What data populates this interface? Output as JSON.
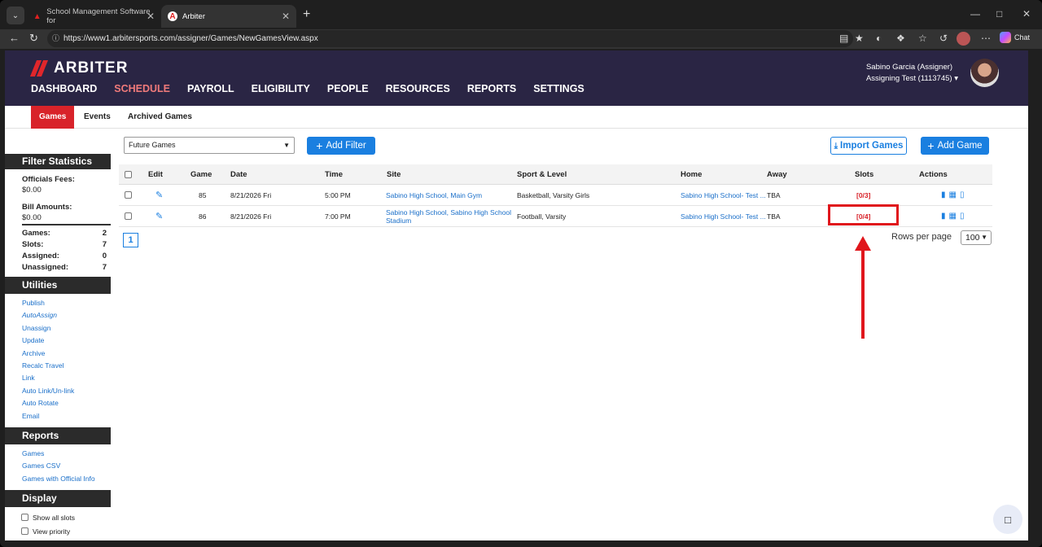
{
  "browser": {
    "tabs": [
      {
        "title": "School Management Software for"
      },
      {
        "title": "Arbiter"
      }
    ],
    "url": "https://www1.arbitersports.com/assigner/Games/NewGamesView.aspx",
    "chat_label": "Chat"
  },
  "header": {
    "brand": "ARBITER",
    "nav": [
      "DASHBOARD",
      "SCHEDULE",
      "PAYROLL",
      "ELIGIBILITY",
      "PEOPLE",
      "RESOURCES",
      "REPORTS",
      "SETTINGS"
    ],
    "active_nav": "SCHEDULE",
    "user_name": "Sabino Garcia (Assigner)",
    "account": "Assigning Test (1113745)"
  },
  "subnav": {
    "tabs": [
      "Games",
      "Events",
      "Archived Games"
    ],
    "active": "Games"
  },
  "sidebar": {
    "filter_title": "Filter Statistics",
    "officials_fees_label": "Officials Fees:",
    "officials_fees_value": "$0.00",
    "bill_amounts_label": "Bill Amounts:",
    "bill_amounts_value": "$0.00",
    "stats": [
      {
        "label": "Games:",
        "value": "2"
      },
      {
        "label": "Slots:",
        "value": "7"
      },
      {
        "label": "Assigned:",
        "value": "0"
      },
      {
        "label": "Unassigned:",
        "value": "7"
      }
    ],
    "utilities_title": "Utilities",
    "utilities": [
      "Publish",
      "AutoAssign",
      "Unassign",
      "Update",
      "Archive",
      "Recalc Travel",
      "Link",
      "Auto Link/Un-link",
      "Auto Rotate",
      "Email"
    ],
    "reports_title": "Reports",
    "reports": [
      "Games",
      "Games CSV",
      "Games with Official Info"
    ],
    "display_title": "Display",
    "display_options": [
      "Show all slots",
      "View priority"
    ]
  },
  "toolbar": {
    "filter_value": "Future Games",
    "add_filter": "Add Filter",
    "import_games": "Import Games",
    "add_game": "Add Game"
  },
  "table": {
    "headers": {
      "edit": "Edit",
      "game": "Game",
      "date": "Date",
      "time": "Time",
      "site": "Site",
      "sport": "Sport & Level",
      "home": "Home",
      "away": "Away",
      "slots": "Slots",
      "actions": "Actions"
    },
    "rows": [
      {
        "game": "85",
        "date": "8/21/2026 Fri",
        "time": "5:00 PM",
        "site": "Sabino High School, Main Gym",
        "sport": "Basketball, Varsity Girls",
        "home": "Sabino High School- Test ...",
        "away": "TBA",
        "slots": "[0/3]"
      },
      {
        "game": "86",
        "date": "8/21/2026 Fri",
        "time": "7:00 PM",
        "site": "Sabino High School, Sabino High School Stadium",
        "sport": "Football, Varsity",
        "home": "Sabino High School- Test ...",
        "away": "TBA",
        "slots": "[0/4]"
      }
    ]
  },
  "pager": {
    "current_page": "1",
    "rows_label": "Rows per page",
    "rows_value": "100"
  },
  "colors": {
    "header_bg": "#2a2544",
    "accent_red": "#d8232a",
    "link_blue": "#1a6fc9",
    "button_blue": "#1a7fe0"
  }
}
